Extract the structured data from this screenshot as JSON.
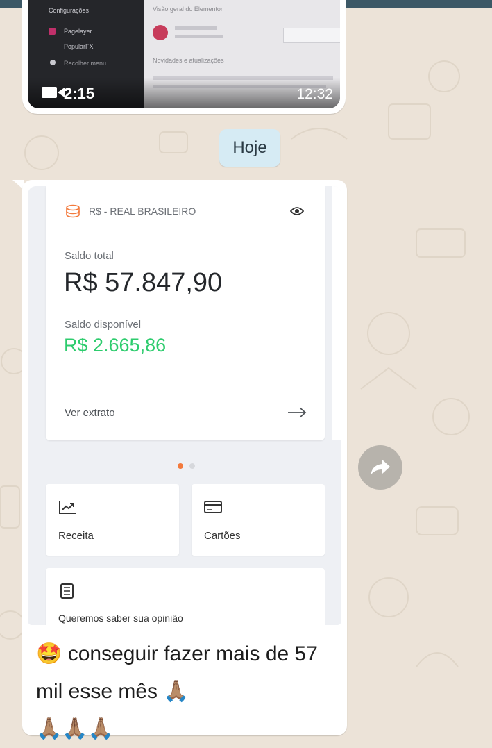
{
  "video_message": {
    "duration": "2:15",
    "time": "12:32",
    "thumbnail": {
      "menu_items": [
        "Configurações",
        "Pagelayer",
        "PopularFX",
        "Recolher menu"
      ],
      "heading": "Visão geral do Elementor",
      "news_label": "Novidades e atualizações"
    }
  },
  "date_divider": "Hoje",
  "bank_screenshot": {
    "currency_label": "R$ - REAL BRASILEIRO",
    "total_label": "Saldo total",
    "total_value": "R$ 57.847,90",
    "available_label": "Saldo disponível",
    "available_value": "R$ 2.665,86",
    "statement_link": "Ver extrato",
    "carousel": {
      "count": 2,
      "active": 0
    },
    "tiles": [
      {
        "label": "Receita",
        "icon": "chart-line-icon"
      },
      {
        "label": "Cartões",
        "icon": "credit-card-icon"
      }
    ],
    "feedback_label": "Queremos saber sua opinião",
    "colors": {
      "accent_orange": "#f37a3c",
      "balance_green": "#2ecc6e"
    }
  },
  "caption": {
    "emoji_start": "🤩",
    "text": "conseguir fazer mais de 57 mil esse mês",
    "emoji_end": "🙏🏽",
    "emoji_trail": "🙏🏽🙏🏽🙏🏽"
  },
  "forward_button": {
    "icon": "forward-arrow-icon"
  }
}
